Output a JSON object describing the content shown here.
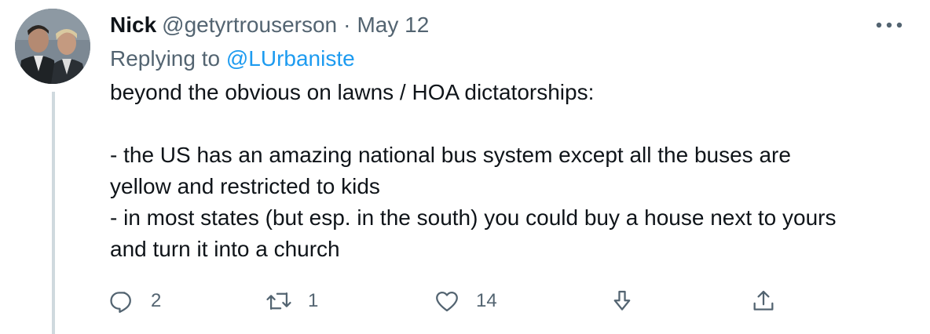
{
  "author": {
    "name": "Nick",
    "handle": "@getyrtrouserson",
    "separator": "·",
    "date": "May 12"
  },
  "reply": {
    "prefix": "Replying to",
    "mention": "@LUrbaniste"
  },
  "tweet_text": [
    "beyond the obvious on lawns / HOA dictatorships:",
    "",
    "- the US has an amazing national bus system except all the buses are",
    "yellow and restricted to kids",
    "- in most states (but esp. in the south) you could buy a house next to yours",
    "and turn it into a church"
  ],
  "actions": {
    "replies": "2",
    "retweets": "1",
    "likes": "14"
  },
  "icons": {
    "more": "more-horizontal-icon",
    "reply": "reply-icon",
    "retweet": "retweet-icon",
    "like": "heart-icon",
    "download": "download-icon",
    "share": "share-icon"
  },
  "colors": {
    "text": "#0f1419",
    "secondary": "#536471",
    "link": "#1d9bf0",
    "thread_line": "#cfd9de"
  }
}
